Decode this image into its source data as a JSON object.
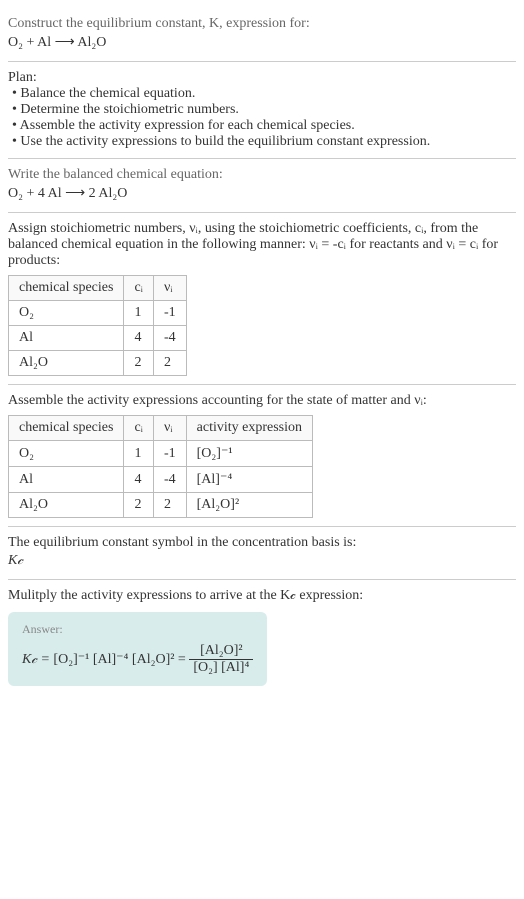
{
  "header": {
    "prompt": "Construct the equilibrium constant, K, expression for:",
    "equation": "O₂ + Al ⟶ Al₂O"
  },
  "plan": {
    "title": "Plan:",
    "items": [
      "• Balance the chemical equation.",
      "• Determine the stoichiometric numbers.",
      "• Assemble the activity expression for each chemical species.",
      "• Use the activity expressions to build the equilibrium constant expression."
    ]
  },
  "balanced": {
    "prompt": "Write the balanced chemical equation:",
    "equation": "O₂ + 4 Al ⟶ 2 Al₂O"
  },
  "stoich": {
    "intro": "Assign stoichiometric numbers, νᵢ, using the stoichiometric coefficients, cᵢ, from the balanced chemical equation in the following manner: νᵢ = -cᵢ for reactants and νᵢ = cᵢ for products:",
    "headers": {
      "species": "chemical species",
      "ci": "cᵢ",
      "vi": "νᵢ"
    },
    "rows": [
      {
        "species": "O₂",
        "ci": "1",
        "vi": "-1"
      },
      {
        "species": "Al",
        "ci": "4",
        "vi": "-4"
      },
      {
        "species": "Al₂O",
        "ci": "2",
        "vi": "2"
      }
    ]
  },
  "activity": {
    "intro": "Assemble the activity expressions accounting for the state of matter and νᵢ:",
    "headers": {
      "species": "chemical species",
      "ci": "cᵢ",
      "vi": "νᵢ",
      "expr": "activity expression"
    },
    "rows": [
      {
        "species": "O₂",
        "ci": "1",
        "vi": "-1",
        "expr": "[O₂]⁻¹"
      },
      {
        "species": "Al",
        "ci": "4",
        "vi": "-4",
        "expr": "[Al]⁻⁴"
      },
      {
        "species": "Al₂O",
        "ci": "2",
        "vi": "2",
        "expr": "[Al₂O]²"
      }
    ]
  },
  "symbol": {
    "line1": "The equilibrium constant symbol in the concentration basis is:",
    "line2": "K𝒸"
  },
  "multiply": {
    "text": "Mulitply the activity expressions to arrive at the K𝒸 expression:"
  },
  "answer": {
    "label": "Answer:",
    "kc": "K𝒸 = ",
    "terms": "[O₂]⁻¹ [Al]⁻⁴ [Al₂O]² = ",
    "num": "[Al₂O]²",
    "den": "[O₂] [Al]⁴"
  },
  "chart_data": {
    "type": "table",
    "title": "Stoichiometric numbers and activity expressions for O₂ + 4 Al ⟶ 2 Al₂O",
    "columns": [
      "chemical species",
      "cᵢ",
      "νᵢ",
      "activity expression"
    ],
    "rows": [
      [
        "O₂",
        1,
        -1,
        "[O₂]^-1"
      ],
      [
        "Al",
        4,
        -4,
        "[Al]^-4"
      ],
      [
        "Al₂O",
        2,
        2,
        "[Al₂O]^2"
      ]
    ],
    "result": "K_c = [Al₂O]^2 / ([O₂] [Al]^4)"
  }
}
